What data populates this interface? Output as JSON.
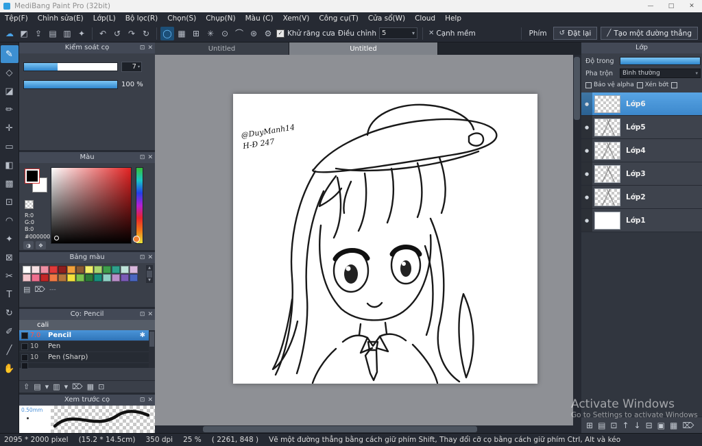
{
  "glyphs": {
    "dropdown": "▾",
    "popup": "⊡",
    "close": "✕",
    "up": "▲",
    "down": "▼"
  },
  "titlebar": {
    "title": "MediBang Paint Pro (32bit)",
    "minimize_glyph": "—",
    "maximize_glyph": "□",
    "close_glyph": "✕"
  },
  "menubar": {
    "items": [
      "Tệp(F)",
      "Chỉnh sửa(E)",
      "Lớp(L)",
      "Bộ lọc(R)",
      "Chọn(S)",
      "Chụp(N)",
      "Màu (C)",
      "Xem(V)",
      "Công cụ(T)",
      "Cửa sổ(W)",
      "Cloud",
      "Help"
    ]
  },
  "toolbar": {
    "file_icons": [
      {
        "name": "cloud-icon",
        "glyph": "☁",
        "color": "#4aa3e8"
      },
      {
        "name": "save-icon",
        "glyph": "◩"
      },
      {
        "name": "export-icon",
        "glyph": "⇪"
      },
      {
        "name": "import-icon",
        "glyph": "▤"
      },
      {
        "name": "copy-icon",
        "glyph": "▥"
      },
      {
        "name": "share-icon",
        "glyph": "✦"
      }
    ],
    "history_icons": [
      {
        "name": "undo-icon",
        "glyph": "↶"
      },
      {
        "name": "undo-history-icon",
        "glyph": "↺"
      },
      {
        "name": "redo-icon",
        "glyph": "↷"
      },
      {
        "name": "redo-history-icon",
        "glyph": "↻"
      }
    ],
    "snap_icons": [
      {
        "name": "snap-off-icon",
        "glyph": "◯",
        "selected": true
      },
      {
        "name": "grid-snap-icon",
        "glyph": "▦"
      },
      {
        "name": "cross-snap-icon",
        "glyph": "⊞"
      },
      {
        "name": "radial-snap-icon",
        "glyph": "✳"
      },
      {
        "name": "circle-snap-icon",
        "glyph": "⊙"
      },
      {
        "name": "curve-snap-icon",
        "glyph": "⌒"
      },
      {
        "name": "vanish-snap-icon",
        "glyph": "⊛"
      },
      {
        "name": "snap-settings-icon",
        "glyph": "⚙"
      }
    ],
    "antialias_check_glyph": "✓",
    "antialias_label": "Khử răng cưa",
    "adjust_label": "Điều chỉnh",
    "adjust_value": "5",
    "soft_edge_icon_glyph": "✕",
    "soft_edge_label": "Cạnh mềm",
    "key_label": "Phím",
    "reset_icon_glyph": "↺",
    "reset_label": "Đặt lại",
    "line_icon_glyph": "╱",
    "line_label": "Tạo một đường thẳng"
  },
  "tools": {
    "items": [
      {
        "name": "brush-tool",
        "glyph": "✎",
        "selected": true
      },
      {
        "name": "eraser-tool",
        "glyph": "◇"
      },
      {
        "name": "stamp-tool",
        "glyph": "◪"
      },
      {
        "name": "dot-pen-tool",
        "glyph": "✏"
      },
      {
        "name": "move-tool",
        "glyph": "✛"
      },
      {
        "name": "rect-fill-tool",
        "glyph": "▭"
      },
      {
        "name": "bucket-tool",
        "glyph": "◧"
      },
      {
        "name": "gradient-tool",
        "glyph": "▩"
      },
      {
        "name": "select-tool",
        "glyph": "⊡"
      },
      {
        "name": "lasso-tool",
        "glyph": "◠"
      },
      {
        "name": "wand-tool",
        "glyph": "✦"
      },
      {
        "name": "transform-tool",
        "glyph": "⊠"
      },
      {
        "name": "divide-tool",
        "glyph": "✂"
      },
      {
        "name": "text-tool",
        "glyph": "T"
      },
      {
        "name": "rotate-tool",
        "glyph": "↻"
      },
      {
        "name": "eyedropper-tool",
        "glyph": "✐"
      },
      {
        "name": "slice-tool",
        "glyph": "╱"
      },
      {
        "name": "hand-tool",
        "glyph": "✋"
      }
    ]
  },
  "brush_control": {
    "title": "Kiểm soát cọ",
    "size_value": "7",
    "opacity_value": "100 %"
  },
  "color_panel": {
    "title": "Màu",
    "r": "R:0",
    "g": "G:0",
    "b": "B:0",
    "hex": "#000000",
    "mode_icon_glyph": "◑",
    "wheel_icon_glyph": "❖"
  },
  "palette_panel": {
    "title": "Bảng màu",
    "row1": [
      "#ffffff",
      "#f6dfe2",
      "#ef8fa4",
      "#e03a3a",
      "#8e1f1f",
      "#f2a13c",
      "#8a5a33",
      "#f3ef6a",
      "#a8d56f",
      "#3f9e4d",
      "#2fa08c",
      "#bfe3da",
      "#d9b8dd"
    ],
    "row2": [
      "#f3c6cd",
      "#ee6f8e",
      "#c22727",
      "#f07a45",
      "#b5763c",
      "#f5e23c",
      "#7bc24f",
      "#2c7a38",
      "#18917e",
      "#8fd0c5",
      "#b98fc9",
      "#7a5ab5",
      "#4a66c0"
    ],
    "new_icon_glyph": "▤",
    "trash_icon_glyph": "⌦",
    "dash_label": "---"
  },
  "brush_panel": {
    "title": "Cọ: Pencil",
    "group_value": "cali",
    "gear_glyph": "✱",
    "items": [
      {
        "size": "7.0",
        "name": "Pencil",
        "selected": true
      },
      {
        "size": "10",
        "name": "Pen"
      },
      {
        "size": "10",
        "name": "Pen (Sharp)"
      }
    ],
    "bottom_icons": [
      {
        "name": "upload-brush-icon",
        "glyph": "⇧"
      },
      {
        "name": "add-brush-icon",
        "glyph": "▤"
      },
      {
        "name": "add-brush-menu-icon",
        "glyph": "▾"
      },
      {
        "name": "edit-brush-icon",
        "glyph": "▥"
      },
      {
        "name": "edit-brush-menu-icon",
        "glyph": "▾"
      },
      {
        "name": "delete-brush-icon",
        "glyph": "⌦"
      },
      {
        "name": "folder-brush-icon",
        "glyph": "▦"
      },
      {
        "name": "duplicate-brush-icon",
        "glyph": "⊡"
      }
    ]
  },
  "preview_panel": {
    "title": "Xem trước cọ",
    "size_label": "0.50mm"
  },
  "canvas": {
    "tabs": [
      {
        "label": "Untitled"
      },
      {
        "label": "Untitled",
        "selected": true
      }
    ],
    "signature_line1": "@DuyManh14",
    "signature_line2": "H-Đ 247"
  },
  "layers_panel": {
    "title": "Lớp",
    "opacity_label": "Độ trong",
    "blend_label": "Pha trộn",
    "blend_value": "Bình thường",
    "alpha_label": "Bảo vệ alpha",
    "clip_label": "Xén bớt",
    "eye_glyph": "●",
    "items": [
      {
        "name": "Lớp6",
        "thumb": "checker",
        "selected": true
      },
      {
        "name": "Lớp5",
        "thumb": "sketch"
      },
      {
        "name": "Lớp4",
        "thumb": "sketch"
      },
      {
        "name": "Lớp3",
        "thumb": "sketch"
      },
      {
        "name": "Lớp2",
        "thumb": "sketch"
      },
      {
        "name": "Lớp1",
        "thumb": "white"
      }
    ],
    "bottom_icons": [
      {
        "name": "add-layer-icon",
        "glyph": "⊞"
      },
      {
        "name": "add-folder-icon",
        "glyph": "▤"
      },
      {
        "name": "duplicate-layer-icon",
        "glyph": "⊡"
      },
      {
        "name": "move-up-icon",
        "glyph": "↑"
      },
      {
        "name": "move-down-icon",
        "glyph": "↓"
      },
      {
        "name": "merge-layer-icon",
        "glyph": "⊟"
      },
      {
        "name": "combine-layer-icon",
        "glyph": "▣"
      },
      {
        "name": "clear-layer-icon",
        "glyph": "▦"
      },
      {
        "name": "delete-layer-icon",
        "glyph": "⌦"
      }
    ]
  },
  "statusbar": {
    "fields": [
      "2095 * 2000 pixel",
      "(15.2 * 14.5cm)",
      "350 dpi",
      "25 %",
      "( 2261, 848 )",
      "Vẽ một đường thẳng bằng cách giữ phím Shift, Thay đổi cỡ cọ bằng cách giữ phím Ctrl, Alt và kéo"
    ]
  },
  "watermark": {
    "line1": "Activate Windows",
    "line2": "Go to Settings to activate Windows"
  }
}
